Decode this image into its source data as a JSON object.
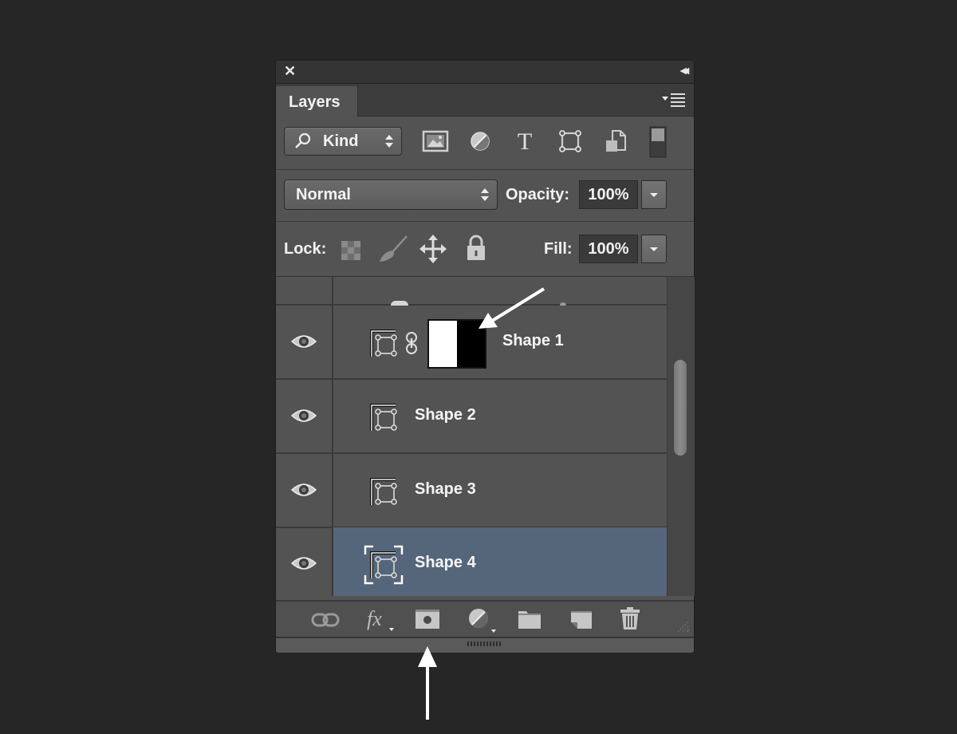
{
  "panel": {
    "close_icon": "close-icon",
    "collapse_icon": "double-chevron-left-icon",
    "tab_label": "Layers",
    "menu_icon": "panel-menu-icon"
  },
  "filter": {
    "kind_label": "Kind",
    "filter_icons": [
      "pixel-layer-filter-icon",
      "adjustment-layer-filter-icon",
      "type-layer-filter-icon",
      "shape-layer-filter-icon",
      "smart-object-filter-icon",
      "filter-toggle-switch"
    ]
  },
  "blend": {
    "mode": "Normal",
    "opacity_label": "Opacity:",
    "opacity_value": "100%"
  },
  "lock": {
    "label": "Lock:",
    "icons": [
      "lock-transparent-pixels-icon",
      "lock-image-pixels-icon",
      "lock-position-icon",
      "lock-all-icon"
    ],
    "fill_label": "Fill:",
    "fill_value": "100%"
  },
  "layers": [
    {
      "name": "Shape 1",
      "visible": true,
      "has_mask": true,
      "selected": false
    },
    {
      "name": "Shape 2",
      "visible": true,
      "has_mask": false,
      "selected": false
    },
    {
      "name": "Shape 3",
      "visible": true,
      "has_mask": false,
      "selected": false
    },
    {
      "name": "Shape 4",
      "visible": true,
      "has_mask": false,
      "selected": true
    }
  ],
  "bottom_bar": {
    "icons": [
      "link-layers-icon",
      "layer-style-fx-icon",
      "add-layer-mask-icon",
      "new-adjustment-layer-icon",
      "new-group-folder-icon",
      "new-layer-icon",
      "delete-layer-trash-icon"
    ]
  },
  "colors": {
    "background": "#262626",
    "panel": "#535353",
    "selected_row": "#56667a"
  }
}
